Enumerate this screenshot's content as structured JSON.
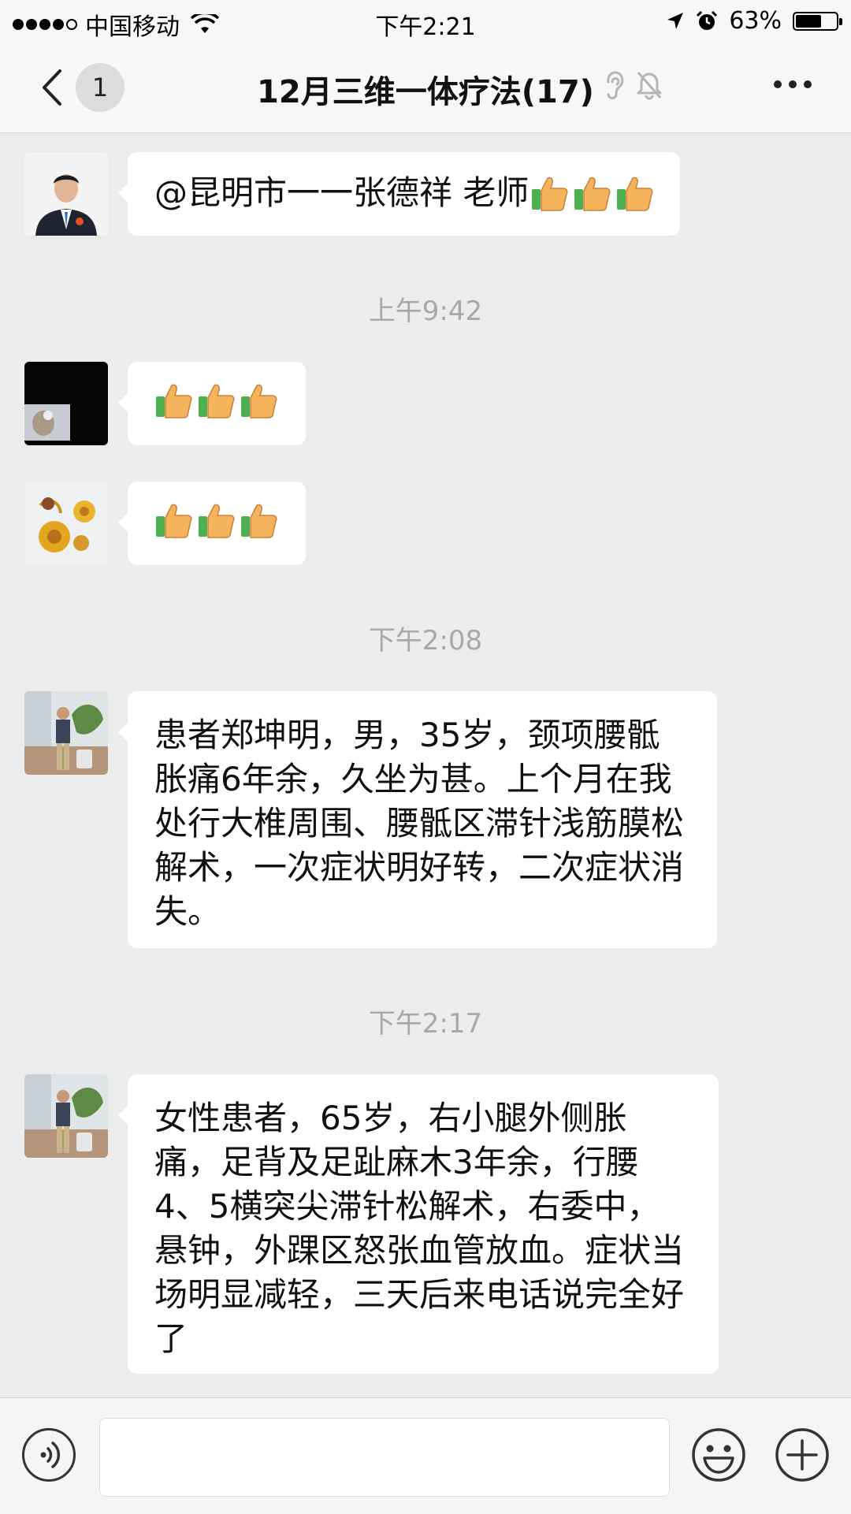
{
  "status_bar": {
    "carrier": "中国移动",
    "time": "下午2:21",
    "battery_text": "63%",
    "battery_level": 0.63
  },
  "nav": {
    "unread_count": "1",
    "title": "12月三维一体疗法(17)"
  },
  "messages": [
    {
      "text": "@昆明市一一张德祥 老师",
      "thumbs": 3,
      "avatar": "avatar-man-suit"
    },
    {
      "timestamp": "上午9:42"
    },
    {
      "thumbs": 3,
      "avatar": "avatar-dark-photo"
    },
    {
      "thumbs": 3,
      "avatar": "avatar-flowers"
    },
    {
      "timestamp": "下午2:08"
    },
    {
      "text": "患者郑坤明，男，35岁，颈项腰骶胀痛6年余，久坐为甚。上个月在我处行大椎周围、腰骶区滞针浅筋膜松解术，一次症状明好转，二次症状消失。",
      "avatar": "avatar-man-standing"
    },
    {
      "timestamp": "下午2:17"
    },
    {
      "text": "女性患者，65岁，右小腿外侧胀痛，足背及足趾麻木3年余，行腰4、5横突尖滞针松解术，右委中，悬钟，外踝区怒张血管放血。症状当场明显减轻，三天后来电话说完全好了",
      "avatar": "avatar-man-standing"
    }
  ],
  "chat": {
    "msg1_text": "@昆明市一一张德祥 老师",
    "ts1": "上午9:42",
    "ts2": "下午2:08",
    "msg4_text": "患者郑坤明，男，35岁，颈项腰骶胀痛6年余，久坐为甚。上个月在我处行大椎周围、腰骶区滞针浅筋膜松解术，一次症状明好转，二次症状消失。",
    "ts3": "下午2:17",
    "msg5_text": "女性患者，65岁，右小腿外侧胀痛，足背及足趾麻木3年余，行腰4、5横突尖滞针松解术，右委中，悬钟，外踝区怒张血管放血。症状当场明显减轻，三天后来电话说完全好了"
  },
  "colors": {
    "background": "#ececec",
    "bubble": "#ffffff",
    "timestamp": "#a8a8a8",
    "bar": "#f7f7f7"
  },
  "icons": [
    "back-icon",
    "wifi-icon",
    "location-icon",
    "alarm-icon",
    "ear-icon",
    "mute-bell-icon",
    "more-icon",
    "voice-icon",
    "emoji-icon",
    "plus-icon",
    "thumbs-up-icon"
  ]
}
